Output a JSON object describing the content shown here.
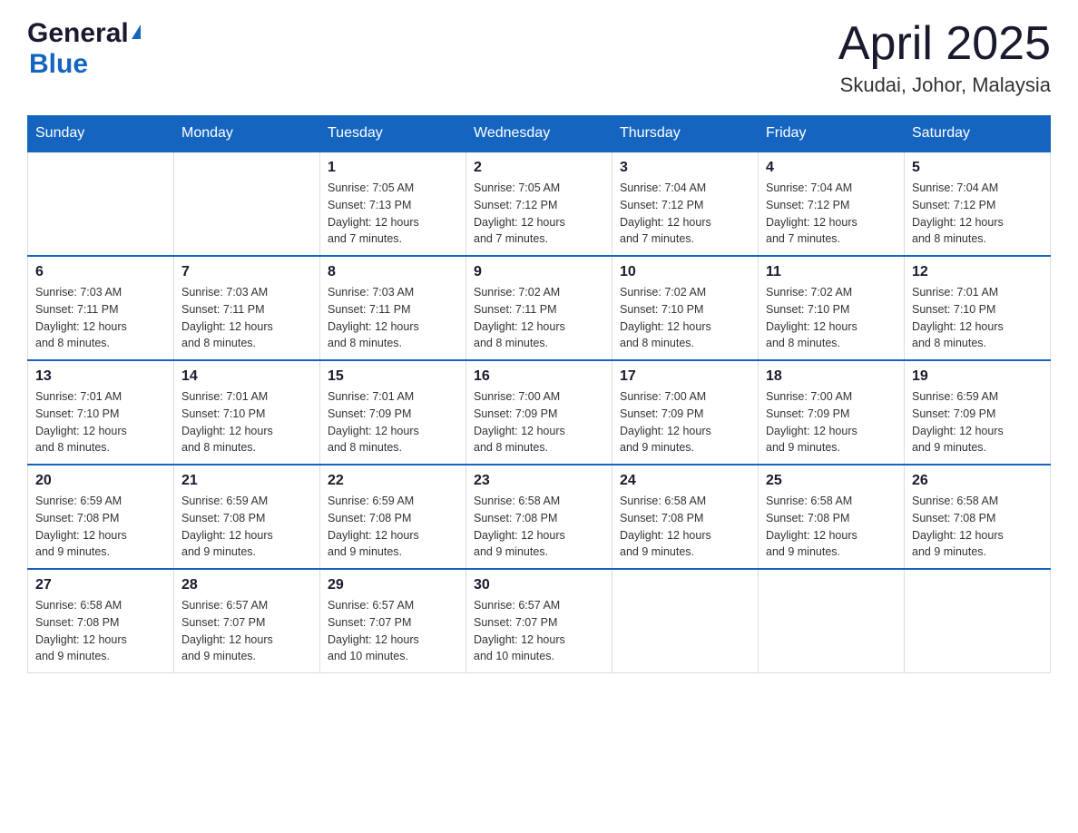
{
  "logo": {
    "text_general": "General",
    "arrow": "▲",
    "text_blue": "Blue"
  },
  "title": "April 2025",
  "location": "Skudai, Johor, Malaysia",
  "weekdays": [
    "Sunday",
    "Monday",
    "Tuesday",
    "Wednesday",
    "Thursday",
    "Friday",
    "Saturday"
  ],
  "weeks": [
    [
      {
        "day": "",
        "info": ""
      },
      {
        "day": "",
        "info": ""
      },
      {
        "day": "1",
        "info": "Sunrise: 7:05 AM\nSunset: 7:13 PM\nDaylight: 12 hours\nand 7 minutes."
      },
      {
        "day": "2",
        "info": "Sunrise: 7:05 AM\nSunset: 7:12 PM\nDaylight: 12 hours\nand 7 minutes."
      },
      {
        "day": "3",
        "info": "Sunrise: 7:04 AM\nSunset: 7:12 PM\nDaylight: 12 hours\nand 7 minutes."
      },
      {
        "day": "4",
        "info": "Sunrise: 7:04 AM\nSunset: 7:12 PM\nDaylight: 12 hours\nand 7 minutes."
      },
      {
        "day": "5",
        "info": "Sunrise: 7:04 AM\nSunset: 7:12 PM\nDaylight: 12 hours\nand 8 minutes."
      }
    ],
    [
      {
        "day": "6",
        "info": "Sunrise: 7:03 AM\nSunset: 7:11 PM\nDaylight: 12 hours\nand 8 minutes."
      },
      {
        "day": "7",
        "info": "Sunrise: 7:03 AM\nSunset: 7:11 PM\nDaylight: 12 hours\nand 8 minutes."
      },
      {
        "day": "8",
        "info": "Sunrise: 7:03 AM\nSunset: 7:11 PM\nDaylight: 12 hours\nand 8 minutes."
      },
      {
        "day": "9",
        "info": "Sunrise: 7:02 AM\nSunset: 7:11 PM\nDaylight: 12 hours\nand 8 minutes."
      },
      {
        "day": "10",
        "info": "Sunrise: 7:02 AM\nSunset: 7:10 PM\nDaylight: 12 hours\nand 8 minutes."
      },
      {
        "day": "11",
        "info": "Sunrise: 7:02 AM\nSunset: 7:10 PM\nDaylight: 12 hours\nand 8 minutes."
      },
      {
        "day": "12",
        "info": "Sunrise: 7:01 AM\nSunset: 7:10 PM\nDaylight: 12 hours\nand 8 minutes."
      }
    ],
    [
      {
        "day": "13",
        "info": "Sunrise: 7:01 AM\nSunset: 7:10 PM\nDaylight: 12 hours\nand 8 minutes."
      },
      {
        "day": "14",
        "info": "Sunrise: 7:01 AM\nSunset: 7:10 PM\nDaylight: 12 hours\nand 8 minutes."
      },
      {
        "day": "15",
        "info": "Sunrise: 7:01 AM\nSunset: 7:09 PM\nDaylight: 12 hours\nand 8 minutes."
      },
      {
        "day": "16",
        "info": "Sunrise: 7:00 AM\nSunset: 7:09 PM\nDaylight: 12 hours\nand 8 minutes."
      },
      {
        "day": "17",
        "info": "Sunrise: 7:00 AM\nSunset: 7:09 PM\nDaylight: 12 hours\nand 9 minutes."
      },
      {
        "day": "18",
        "info": "Sunrise: 7:00 AM\nSunset: 7:09 PM\nDaylight: 12 hours\nand 9 minutes."
      },
      {
        "day": "19",
        "info": "Sunrise: 6:59 AM\nSunset: 7:09 PM\nDaylight: 12 hours\nand 9 minutes."
      }
    ],
    [
      {
        "day": "20",
        "info": "Sunrise: 6:59 AM\nSunset: 7:08 PM\nDaylight: 12 hours\nand 9 minutes."
      },
      {
        "day": "21",
        "info": "Sunrise: 6:59 AM\nSunset: 7:08 PM\nDaylight: 12 hours\nand 9 minutes."
      },
      {
        "day": "22",
        "info": "Sunrise: 6:59 AM\nSunset: 7:08 PM\nDaylight: 12 hours\nand 9 minutes."
      },
      {
        "day": "23",
        "info": "Sunrise: 6:58 AM\nSunset: 7:08 PM\nDaylight: 12 hours\nand 9 minutes."
      },
      {
        "day": "24",
        "info": "Sunrise: 6:58 AM\nSunset: 7:08 PM\nDaylight: 12 hours\nand 9 minutes."
      },
      {
        "day": "25",
        "info": "Sunrise: 6:58 AM\nSunset: 7:08 PM\nDaylight: 12 hours\nand 9 minutes."
      },
      {
        "day": "26",
        "info": "Sunrise: 6:58 AM\nSunset: 7:08 PM\nDaylight: 12 hours\nand 9 minutes."
      }
    ],
    [
      {
        "day": "27",
        "info": "Sunrise: 6:58 AM\nSunset: 7:08 PM\nDaylight: 12 hours\nand 9 minutes."
      },
      {
        "day": "28",
        "info": "Sunrise: 6:57 AM\nSunset: 7:07 PM\nDaylight: 12 hours\nand 9 minutes."
      },
      {
        "day": "29",
        "info": "Sunrise: 6:57 AM\nSunset: 7:07 PM\nDaylight: 12 hours\nand 10 minutes."
      },
      {
        "day": "30",
        "info": "Sunrise: 6:57 AM\nSunset: 7:07 PM\nDaylight: 12 hours\nand 10 minutes."
      },
      {
        "day": "",
        "info": ""
      },
      {
        "day": "",
        "info": ""
      },
      {
        "day": "",
        "info": ""
      }
    ]
  ]
}
